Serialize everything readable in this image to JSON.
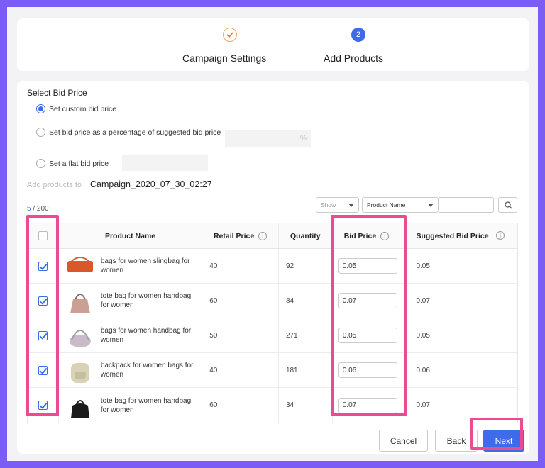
{
  "steps": [
    {
      "label": "Campaign Settings",
      "state": "done",
      "icon": "check-icon"
    },
    {
      "label": "Add Products",
      "number": "2",
      "state": "active"
    }
  ],
  "bid": {
    "title": "Select Bid Price",
    "options": [
      {
        "label": "Set custom bid price",
        "selected": true
      },
      {
        "label": "Set bid price as a percentage of suggested bid price",
        "selected": false,
        "suffix": "%"
      },
      {
        "label": "Set a flat bid price",
        "selected": false
      }
    ]
  },
  "campaign": {
    "label": "Add products to",
    "name": "Campaign_2020_07_30_02:27"
  },
  "count": {
    "selected": "5",
    "total": "/ 200"
  },
  "filters": {
    "show_placeholder": "Show",
    "field": "Product Name",
    "search_value": ""
  },
  "table": {
    "headers": {
      "name": "Product Name",
      "retail": "Retail Price",
      "quantity": "Quantity",
      "bid": "Bid Price",
      "suggested": "Suggested Bid Price"
    },
    "rows": [
      {
        "name": "bags for women slingbag for women",
        "retail": "40",
        "quantity": "92",
        "bid": "0.05",
        "suggested": "0.05",
        "checked": true,
        "thumb_color": "#d9582b"
      },
      {
        "name": "tote bag for women handbag for women",
        "retail": "60",
        "quantity": "84",
        "bid": "0.07",
        "suggested": "0.07",
        "checked": true,
        "thumb_color": "#c9a093"
      },
      {
        "name": "bags for women handbag for women",
        "retail": "50",
        "quantity": "271",
        "bid": "0.05",
        "suggested": "0.05",
        "checked": true,
        "thumb_color": "#c9bcc8"
      },
      {
        "name": "backpack for women bags for women",
        "retail": "40",
        "quantity": "181",
        "bid": "0.06",
        "suggested": "0.06",
        "checked": true,
        "thumb_color": "#d8d2b6"
      },
      {
        "name": "tote bag for women handbag for women",
        "retail": "60",
        "quantity": "34",
        "bid": "0.07",
        "suggested": "0.07",
        "checked": true,
        "thumb_color": "#1a1a1a"
      }
    ]
  },
  "buttons": {
    "cancel": "Cancel",
    "back": "Back",
    "next": "Next"
  },
  "colors": {
    "accent": "#3d6bea",
    "highlight": "#ec4b94",
    "background": "#7b5cf5"
  }
}
